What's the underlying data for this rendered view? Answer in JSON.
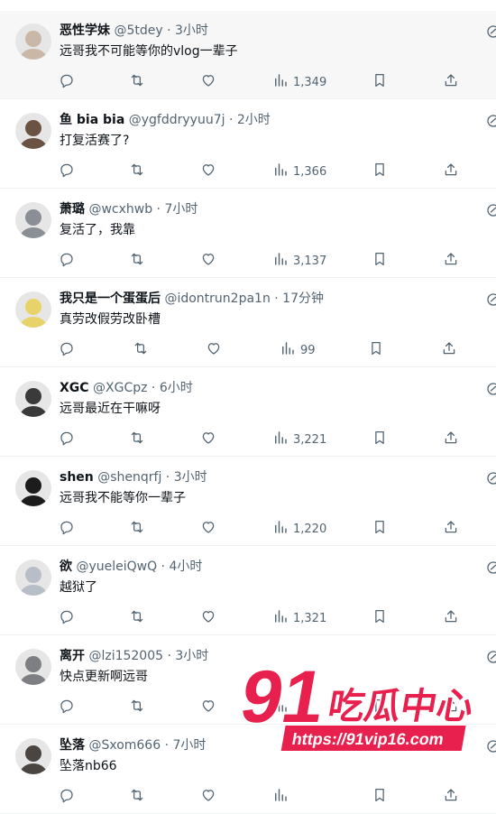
{
  "tweets": [
    {
      "name": "恶性学妹",
      "handle": "@5tdey",
      "time": "3小时",
      "text": "远哥我不可能等你的vlog一辈子",
      "views": "1,349",
      "avatar_color": "#c9b7a8"
    },
    {
      "name": "鱼 bia bia",
      "handle": "@ygfddryyuu7j",
      "time": "2小时",
      "text": "打复活赛了?",
      "views": "1,366",
      "avatar_color": "#6b5344"
    },
    {
      "name": "萧璐",
      "handle": "@wcxhwb",
      "time": "7小时",
      "text": "复活了，我靠",
      "views": "3,137",
      "avatar_color": "#8a8e95"
    },
    {
      "name": "我只是一个蛋蛋后",
      "handle": "@idontrun2pa1n",
      "time": "17分钟",
      "text": "真劳改假劳改卧槽",
      "views": "99",
      "avatar_color": "#e8d36a"
    },
    {
      "name": "XGC",
      "handle": "@XGCpz",
      "time": "6小时",
      "text": "远哥最近在干嘛呀",
      "views": "3,221",
      "avatar_color": "#3a3a3a"
    },
    {
      "name": "shen",
      "handle": "@shenqrfj",
      "time": "3小时",
      "text": "远哥我不能等你一辈子",
      "views": "1,220",
      "avatar_color": "#1c1c1c"
    },
    {
      "name": "欲",
      "handle": "@yueleiQwQ",
      "time": "4小时",
      "text": "越狱了",
      "views": "1,321",
      "avatar_color": "#b8bec8"
    },
    {
      "name": "离开",
      "handle": "@lzi152005",
      "time": "3小时",
      "text": "快点更新啊远哥",
      "views": "",
      "avatar_color": "#7d7f83"
    },
    {
      "name": "坠落",
      "handle": "@Sxom666",
      "time": "7小时",
      "text": "坠落nb66",
      "views": "",
      "avatar_color": "#4a4540"
    }
  ],
  "watermark": {
    "big": "91",
    "cn": "吃瓜中心",
    "url": "https://91vip16.com",
    "color": "#e8204d"
  },
  "colors": {
    "text": "#0f1419",
    "muted": "#536471",
    "border": "#eff3f4"
  }
}
